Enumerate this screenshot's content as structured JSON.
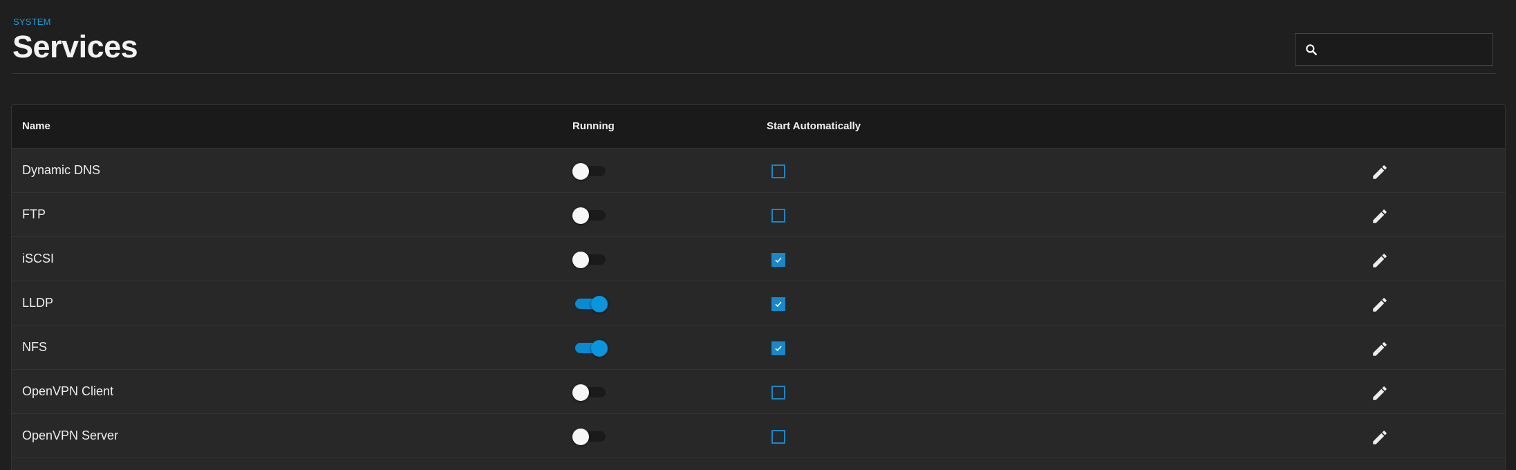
{
  "header": {
    "breadcrumb": "SYSTEM",
    "title": "Services",
    "search": {
      "value": "",
      "placeholder": ""
    }
  },
  "table": {
    "columns": {
      "name": "Name",
      "running": "Running",
      "start_automatically": "Start Automatically"
    },
    "rows": [
      {
        "name": "Dynamic DNS",
        "running": false,
        "start_automatically": false
      },
      {
        "name": "FTP",
        "running": false,
        "start_automatically": false
      },
      {
        "name": "iSCSI",
        "running": false,
        "start_automatically": true
      },
      {
        "name": "LLDP",
        "running": true,
        "start_automatically": true
      },
      {
        "name": "NFS",
        "running": true,
        "start_automatically": true
      },
      {
        "name": "OpenVPN Client",
        "running": false,
        "start_automatically": false
      },
      {
        "name": "OpenVPN Server",
        "running": false,
        "start_automatically": false
      }
    ]
  },
  "icons": {
    "search": "search-icon",
    "edit": "pencil-icon",
    "check": "check-icon"
  },
  "colors": {
    "accent": "#1e9ad6",
    "toggle_on": "#0a95dd",
    "checkbox": "#1a87c9",
    "background": "#1f1f1f",
    "card": "#282828",
    "table_header": "#1a1a1a"
  }
}
